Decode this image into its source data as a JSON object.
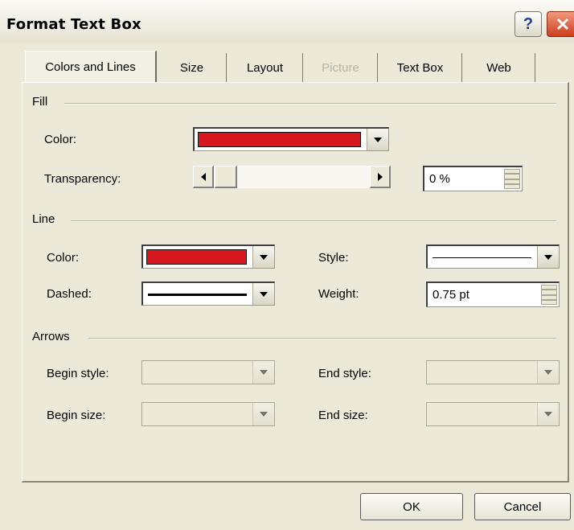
{
  "window": {
    "title": "Format Text Box",
    "help_label": "?"
  },
  "tabs": [
    {
      "label": "Colors and Lines",
      "state": "active"
    },
    {
      "label": "Size",
      "state": "normal"
    },
    {
      "label": "Layout",
      "state": "normal"
    },
    {
      "label": "Picture",
      "state": "disabled"
    },
    {
      "label": "Text Box",
      "state": "normal"
    },
    {
      "label": "Web",
      "state": "normal"
    }
  ],
  "fill": {
    "heading": "Fill",
    "color_label": "Color:",
    "color_value": "#d7181e",
    "transparency_label": "Transparency:",
    "transparency_value": "0 %",
    "transparency_level": 0
  },
  "line": {
    "heading": "Line",
    "color_label": "Color:",
    "color_value": "#d7181e",
    "dashed_label": "Dashed:",
    "style_label": "Style:",
    "weight_label": "Weight:",
    "weight_value": "0.75 pt"
  },
  "arrows": {
    "heading": "Arrows",
    "begin_style_label": "Begin style:",
    "begin_size_label": "Begin size:",
    "end_style_label": "End style:",
    "end_size_label": "End size:"
  },
  "buttons": {
    "ok": "OK",
    "cancel": "Cancel"
  }
}
